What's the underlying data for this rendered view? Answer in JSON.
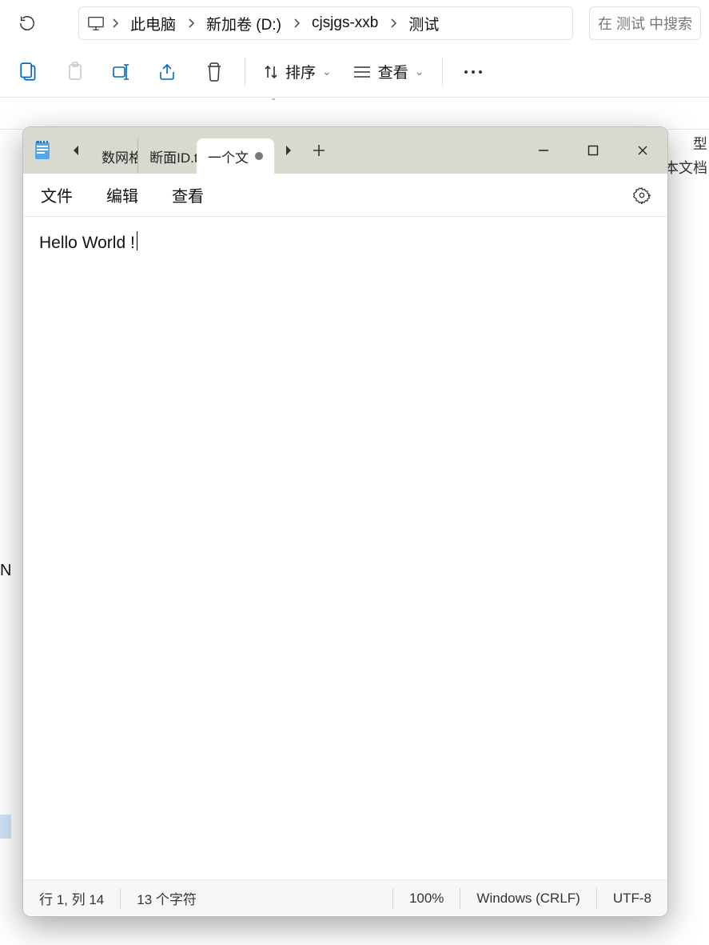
{
  "explorer": {
    "breadcrumbs": [
      "此电脑",
      "新加卷 (D:)",
      "cjsjgs-xxb",
      "测试"
    ],
    "search_placeholder": "在 测试 中搜索",
    "toolbar": {
      "sort_label": "排序",
      "view_label": "查看"
    },
    "column_header_hint_type": "型",
    "peek_type": "本文档",
    "peek_left_letter": "N"
  },
  "notepad": {
    "tabs": {
      "prev1": "数网格",
      "prev2": "断面ID.txt",
      "active": "一个文"
    },
    "menu": {
      "file": "文件",
      "edit": "编辑",
      "view": "查看"
    },
    "content": "Hello World !",
    "status": {
      "pos": "行 1,  列 14",
      "chars": "13 个字符",
      "zoom": "100%",
      "eol": "Windows (CRLF)",
      "encoding": "UTF-8"
    }
  }
}
